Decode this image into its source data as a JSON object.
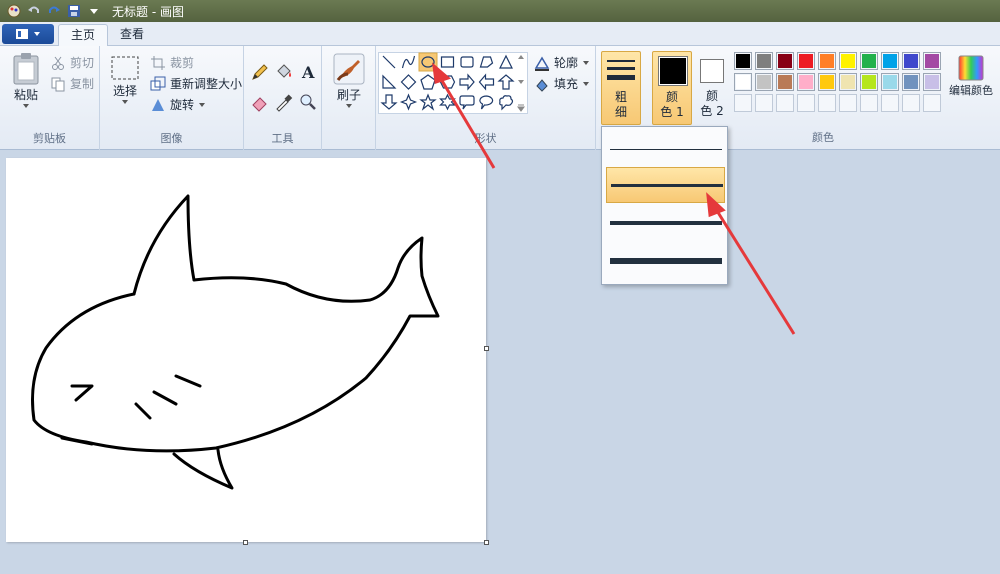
{
  "window": {
    "title": "无标题 - 画图"
  },
  "tabs": {
    "home": "主页",
    "view": "查看"
  },
  "clipboard": {
    "paste": "粘贴",
    "cut": "剪切",
    "copy": "复制",
    "group_label": "剪贴板"
  },
  "image": {
    "select": "选择",
    "crop": "裁剪",
    "resize": "重新调整大小",
    "rotate": "旋转",
    "group_label": "图像"
  },
  "tools": {
    "group_label": "工具"
  },
  "brushes": {
    "label": "刷子"
  },
  "shapes": {
    "outline": "轮廓",
    "fill": "填充",
    "group_label": "形状",
    "items": [
      "line-icon",
      "curve-icon",
      "oval-icon",
      "rectangle-icon",
      "rounded-rectangle-icon",
      "polygon-icon",
      "triangle-icon",
      "right-triangle-icon",
      "diamond-icon",
      "pentagon-icon",
      "hexagon-icon",
      "right-arrow-icon",
      "left-arrow-icon",
      "up-arrow-icon",
      "down-arrow-icon",
      "four-point-star-icon",
      "five-point-star-icon",
      "six-point-star-icon",
      "rounded-callout-icon",
      "oval-callout-icon",
      "cloud-callout-icon"
    ],
    "selected": "oval-icon"
  },
  "size": {
    "label_line1": "粗",
    "label_line2": "细",
    "options": [
      "thin",
      "medium",
      "thick",
      "extra-thick"
    ],
    "selected": "medium"
  },
  "colors": {
    "color1_label_1": "颜",
    "color1_label_2": "色 1",
    "color2_label_1": "颜",
    "color2_label_2": "色 2",
    "edit_colors": "编辑颜色",
    "group_label": "颜色",
    "color1": "#000000",
    "color2": "#ffffff",
    "palette_row1": [
      "#000000",
      "#7f7f7f",
      "#880015",
      "#ed1c24",
      "#ff7f27",
      "#fff200",
      "#22b14c",
      "#00a2e8",
      "#3f48cc",
      "#a349a4"
    ],
    "palette_row2": [
      "#ffffff",
      "#c3c3c3",
      "#b97a57",
      "#ffaec9",
      "#ffc90e",
      "#efe4b0",
      "#b5e61d",
      "#99d9ea",
      "#7092be",
      "#c8bfe7"
    ]
  }
}
